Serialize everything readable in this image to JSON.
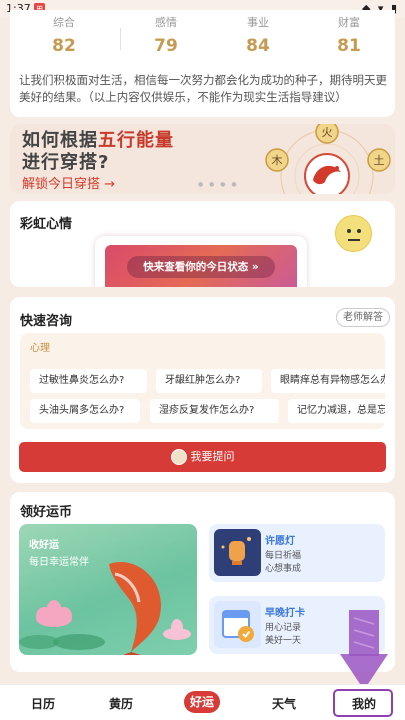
{
  "status_bar": {
    "time": "1:37",
    "notif_badge": "⊞",
    "icons": "◆ ▾ ▮"
  },
  "scores": {
    "items": [
      {
        "label": "综合",
        "value": "82"
      },
      {
        "label": "感情",
        "value": "79"
      },
      {
        "label": "事业",
        "value": "84"
      },
      {
        "label": "财富",
        "value": "81"
      }
    ],
    "description": "让我们积极面对生活，相信每一次努力都会化为成功的种子，期待明天更美好的结果。（以上内容仅供娱乐，不能作为现实生活指导建议）"
  },
  "banner": {
    "line1_prefix": "如何根据",
    "line1_highlight": "五行能量",
    "line2": "进行穿搭?",
    "cta": "解锁今日穿搭 →",
    "element_glyphs": [
      "火",
      "木",
      "土"
    ]
  },
  "mood": {
    "title": "彩虹心情",
    "button_label": "快来查看你的今日状态 »"
  },
  "consult": {
    "title": "快速咨询",
    "master_label": "老师解答",
    "category": "心理",
    "questions_row1": [
      "过敏性鼻炎怎么办?",
      "牙龈红肿怎么办?",
      "眼睛痒总有异物感怎么办?"
    ],
    "questions_row2": [
      "头油头屑多怎么办?",
      "湿疹反复发作怎么办?",
      "记忆力减退，总是忘事"
    ],
    "ask_label": "我要提问"
  },
  "coins": {
    "title": "领好运币",
    "big_card": {
      "title": "收好运",
      "subtitle": "每日幸运常伴"
    },
    "card_wish": {
      "title": "许愿灯",
      "line1": "每日祈福",
      "line2": "心想事成"
    },
    "card_checkin": {
      "title": "早晚打卡",
      "line1": "用心记录",
      "line2": "美好一天"
    }
  },
  "nav": {
    "items": [
      "日历",
      "黄历",
      "好运",
      "天气",
      "我的"
    ],
    "active_index": 2
  },
  "colors": {
    "accent_red": "#d63b37",
    "gold": "#c79a52",
    "annotation_purple": "#8e3fb0"
  }
}
